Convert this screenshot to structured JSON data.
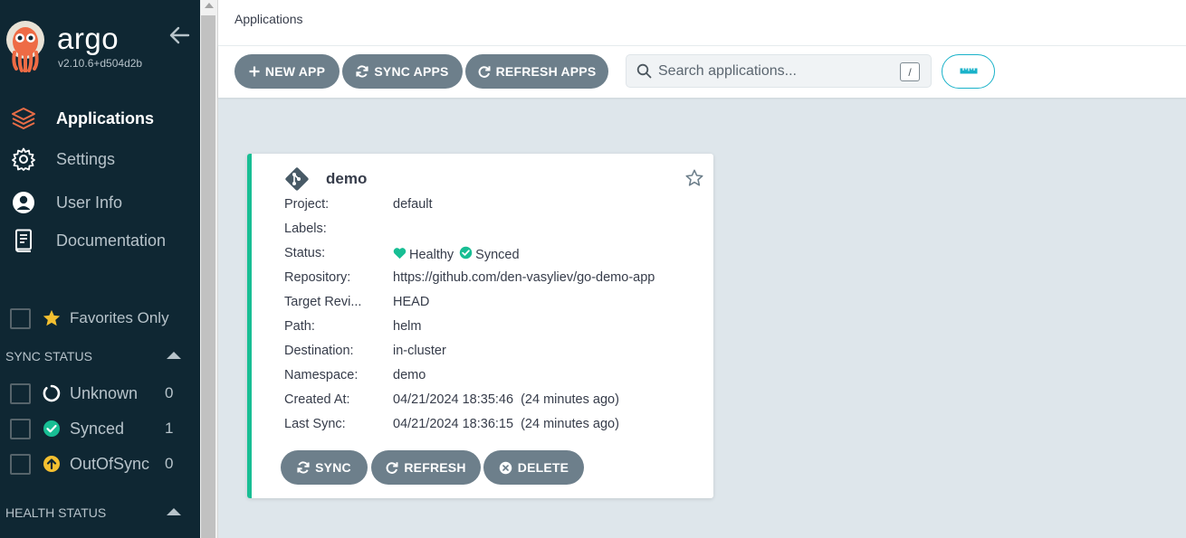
{
  "sidebar": {
    "brand": "argo",
    "version": "v2.10.6+d504d2b",
    "nav": [
      {
        "label": "Applications"
      },
      {
        "label": "Settings"
      },
      {
        "label": "User Info"
      },
      {
        "label": "Documentation"
      }
    ],
    "favorites_label": "Favorites Only",
    "sync_status_title": "SYNC STATUS",
    "sync_filters": [
      {
        "label": "Unknown",
        "count": "0"
      },
      {
        "label": "Synced",
        "count": "1"
      },
      {
        "label": "OutOfSync",
        "count": "0"
      }
    ],
    "health_status_title": "HEALTH STATUS"
  },
  "header": {
    "title": "Applications"
  },
  "toolbar": {
    "new_app": "NEW APP",
    "sync_apps": "SYNC APPS",
    "refresh_apps": "REFRESH APPS",
    "search_placeholder": "Search applications...",
    "search_shortcut": "/"
  },
  "app": {
    "name": "demo",
    "fields": [
      {
        "key": "Project:",
        "value": "default"
      },
      {
        "key": "Labels:",
        "value": ""
      },
      {
        "key": "Status:",
        "health": "Healthy",
        "sync": "Synced"
      },
      {
        "key": "Repository:",
        "value": "https://github.com/den-vasyliev/go-demo-app"
      },
      {
        "key": "Target Revi...",
        "value": "HEAD"
      },
      {
        "key": "Path:",
        "value": "helm"
      },
      {
        "key": "Destination:",
        "value": "in-cluster"
      },
      {
        "key": "Namespace:",
        "value": "demo"
      },
      {
        "key": "Created At:",
        "value": "04/21/2024 18:35:46  (24 minutes ago)"
      },
      {
        "key": "Last Sync:",
        "value": "04/21/2024 18:36:15  (24 minutes ago)"
      }
    ],
    "actions": {
      "sync": "SYNC",
      "refresh": "REFRESH",
      "delete": "DELETE"
    }
  },
  "colors": {
    "sidebar_bg": "#0f2733",
    "button_bg": "#6d7f8b",
    "healthy": "#18be94",
    "accent": "#19b2c9",
    "outofsync": "#f4c030",
    "active_nav_icon": "#e96d47"
  },
  "icons": [
    "argo-logo-icon",
    "arrow-left-icon",
    "layers-icon",
    "gear-icon",
    "user-icon",
    "book-icon",
    "star-icon",
    "circle-notch-icon",
    "check-circle-icon",
    "arrow-up-circle-icon",
    "plus-icon",
    "sync-icon",
    "redo-icon",
    "search-icon",
    "ruler-icon",
    "git-icon",
    "star-outline-icon",
    "heart-icon",
    "times-circle-icon"
  ]
}
